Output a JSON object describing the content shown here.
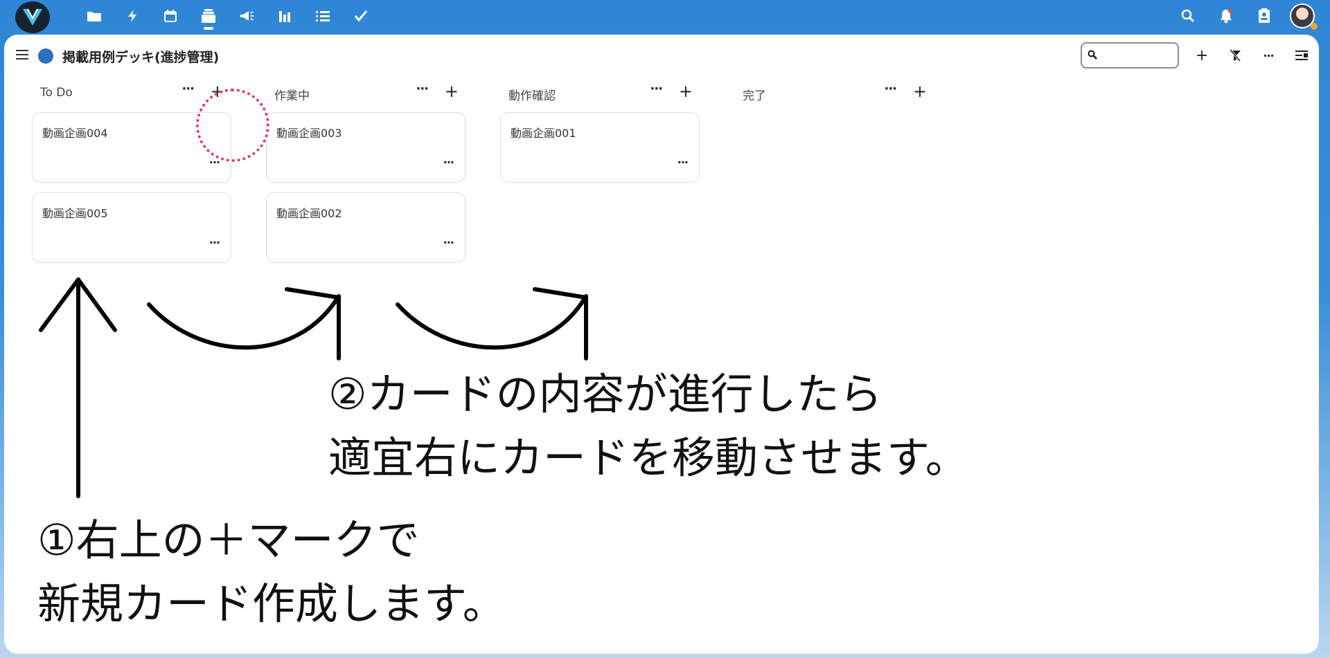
{
  "app": {
    "brand_color": "#2f86d6",
    "nav_icons": [
      "folder-icon",
      "activity-icon",
      "calendar-icon",
      "deck-icon",
      "announcements-icon",
      "analytics-icon",
      "tasks-list-icon",
      "checkmark-icon"
    ],
    "right_icons": [
      "search-icon",
      "notifications-icon",
      "contacts-icon"
    ]
  },
  "board": {
    "title": "掲載用例デッキ(進捗管理)",
    "dot_color": "#2f6fc1",
    "search_placeholder": "",
    "add_symbol": "+",
    "more_symbol": "···"
  },
  "columns": [
    {
      "title": "To Do",
      "more": "···",
      "add": "+",
      "cards": [
        {
          "title": "動画企画004",
          "more": "···"
        },
        {
          "title": "動画企画005",
          "more": "···"
        }
      ]
    },
    {
      "title": "作業中",
      "more": "···",
      "add": "+",
      "cards": [
        {
          "title": "動画企画003",
          "more": "···"
        },
        {
          "title": "動画企画002",
          "more": "···"
        }
      ]
    },
    {
      "title": "動作確認",
      "more": "···",
      "add": "+",
      "cards": [
        {
          "title": "動画企画001",
          "more": "···"
        }
      ]
    },
    {
      "title": "完了",
      "more": "···",
      "add": "+",
      "cards": []
    }
  ],
  "annotations": {
    "step2_line1": "②カードの内容が進行したら",
    "step2_line2": "適宜右にカードを移動させます。",
    "step1_line1": "①右上の＋マークで",
    "step1_line2": "新規カード作成します。",
    "highlight_color": "#e0336f"
  }
}
